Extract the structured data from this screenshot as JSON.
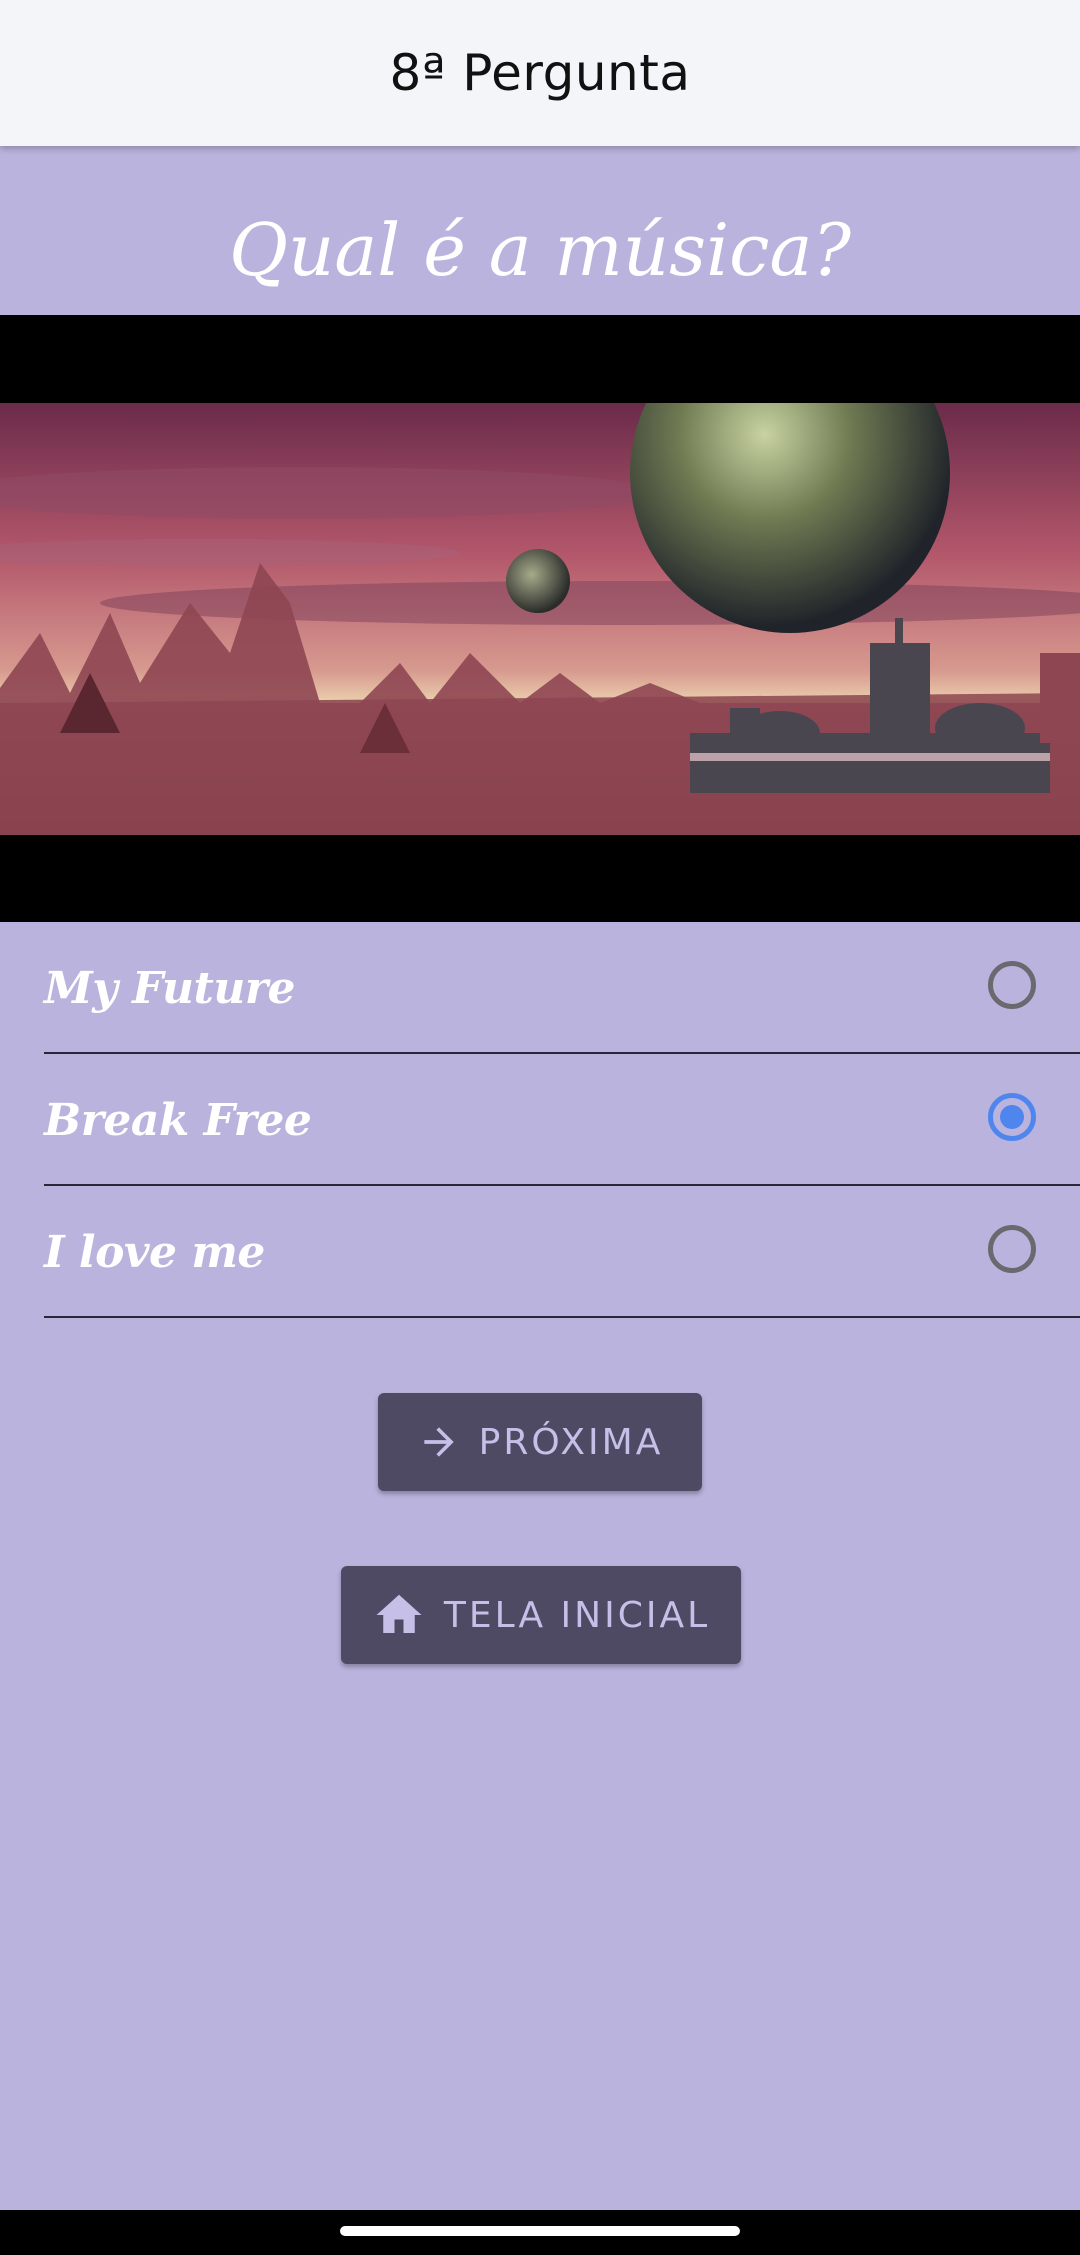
{
  "app_bar": {
    "title": "8ª Pergunta"
  },
  "question": {
    "text": "Qual é a música?"
  },
  "options": [
    {
      "label": "My Future",
      "selected": false
    },
    {
      "label": "Break Free",
      "selected": true
    },
    {
      "label": "I love me",
      "selected": false
    }
  ],
  "buttons": {
    "next": {
      "label": "PRÓXIMA",
      "icon": "arrow-right-icon"
    },
    "home": {
      "label": "TELA INICIAL",
      "icon": "home-icon"
    }
  },
  "colors": {
    "background": "#bab3dd",
    "app_bar": "#f4f5f9",
    "button": "#4f4a63",
    "button_text": "#c6c0e8",
    "radio_selected": "#4f86ee"
  }
}
